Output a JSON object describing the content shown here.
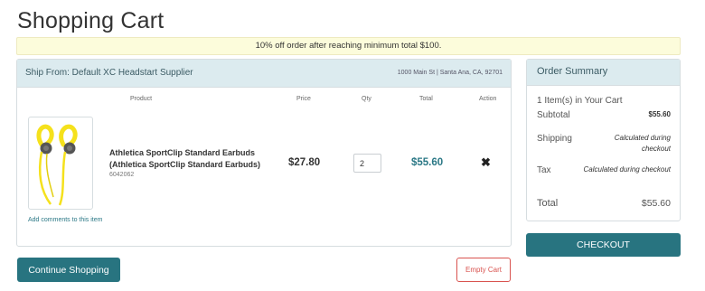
{
  "page": {
    "title": "Shopping Cart"
  },
  "promo": {
    "text": "10% off order after reaching minimum total $100."
  },
  "cart": {
    "ship_from": "Ship From: Default XC Headstart Supplier",
    "ship_address": "1000 Main St | Santa Ana, CA, 92701",
    "columns": {
      "product": "Product",
      "price": "Price",
      "qty": "Qty",
      "total": "Total",
      "action": "Action"
    },
    "items": [
      {
        "name": "Athletica SportClip Standard Earbuds (Athletica SportClip Standard Earbuds)",
        "sku": "6042062",
        "price": "$27.80",
        "qty": "2",
        "total": "$55.60",
        "image_icon": "earbuds-image"
      }
    ],
    "add_comments_label": "Add comments to this item",
    "remove_icon": "✖"
  },
  "summary": {
    "title": "Order Summary",
    "item_count": "1 Item(s) in Your Cart",
    "subtotal_label": "Subtotal",
    "subtotal_value": "$55.60",
    "shipping_label": "Shipping",
    "shipping_value": "Calculated during checkout",
    "tax_label": "Tax",
    "tax_value": "Calculated during checkout",
    "total_label": "Total",
    "total_value": "$55.60"
  },
  "buttons": {
    "checkout": "CHECKOUT",
    "continue": "Continue Shopping",
    "empty_cart": "Empty Cart"
  },
  "colors": {
    "accent": "#287480",
    "header_bg": "#dcebef",
    "promo_bg": "#fcfcdb",
    "danger": "#d9534f",
    "product_yellow": "#f5e11c"
  }
}
